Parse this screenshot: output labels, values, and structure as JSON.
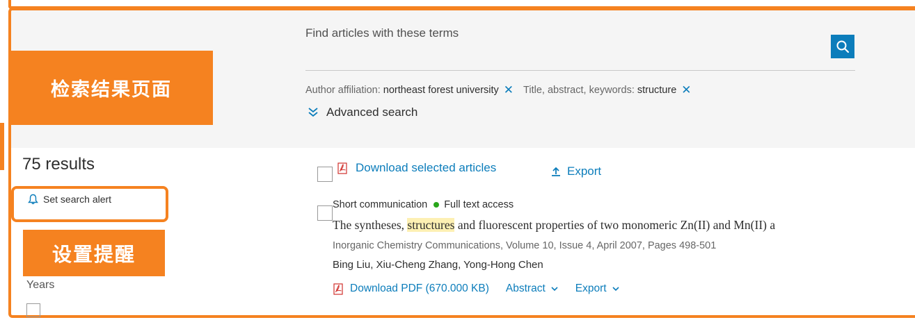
{
  "search": {
    "find_label": "Find articles with these terms",
    "filters": [
      {
        "label": "Author affiliation:",
        "value": "northeast forest university"
      },
      {
        "label": "Title, abstract, keywords:",
        "value": "structure"
      }
    ],
    "advanced_label": "Advanced search"
  },
  "sidebar": {
    "results_count": "75 results",
    "alert_label": "Set search alert",
    "years_label": "Years"
  },
  "callouts": {
    "search_results_page": "检索结果页面",
    "set_alert": "设置提醒"
  },
  "toolbar": {
    "download_label": "Download selected articles",
    "export_label": "Export"
  },
  "article": {
    "type": "Short communication",
    "access": "Full text access",
    "title_before": "The syntheses, ",
    "title_highlight": "structures",
    "title_after": " and fluorescent properties of two monomeric Zn(II) and Mn(II) a",
    "source": "Inorganic Chemistry Communications, Volume 10, Issue 4, April 2007, Pages 498-501",
    "authors": "Bing Liu, Xiu-Cheng Zhang, Yong-Hong Chen",
    "download_pdf": "Download PDF (670.000 KB)",
    "abstract_label": "Abstract",
    "export_label": "Export"
  },
  "colors": {
    "accent_orange": "#f58220",
    "link_blue": "#0c7dbb",
    "access_green": "#29a61b",
    "highlight": "#fdf0b3",
    "pdf_red": "#d0312d"
  },
  "icons": [
    "search-icon",
    "close-icon",
    "double-chevron-down-icon",
    "bell-icon",
    "pdf-icon",
    "upload-icon",
    "chevron-down-icon"
  ]
}
